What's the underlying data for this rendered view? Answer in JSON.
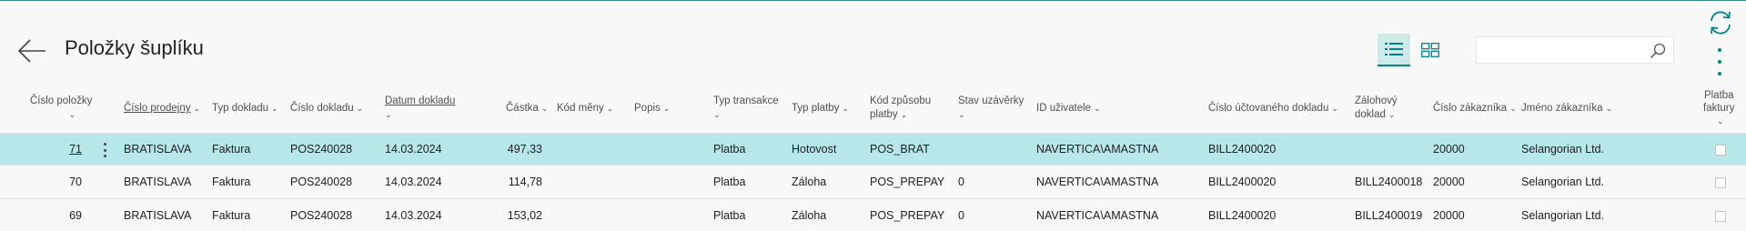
{
  "header": {
    "title": "Položky šuplíku",
    "search": {
      "value": "",
      "placeholder": ""
    },
    "icons": {
      "back": "back-arrow-icon",
      "list_view": "list-view-icon",
      "tile_view": "tile-view-icon",
      "search": "search-icon",
      "refresh": "refresh-icon",
      "more": "more-options-icon"
    },
    "accent_color": "#008489"
  },
  "columns": [
    {
      "key": "cislo_polozky",
      "label1": "Číslo položky",
      "label2": ""
    },
    {
      "key": "cislo_prodejny",
      "label1": "Číslo prodejny",
      "label2": ""
    },
    {
      "key": "typ_dokladu",
      "label1": "Typ dokladu",
      "label2": ""
    },
    {
      "key": "cislo_dokladu",
      "label1": "Číslo dokladu",
      "label2": ""
    },
    {
      "key": "datum_dokladu",
      "label1": "Datum dokladu",
      "label2": ""
    },
    {
      "key": "castka",
      "label1": "Částka",
      "label2": ""
    },
    {
      "key": "kod_meny",
      "label1": "Kód měny",
      "label2": ""
    },
    {
      "key": "popis",
      "label1": "Popis",
      "label2": ""
    },
    {
      "key": "typ_transakce",
      "label1": "Typ transakce",
      "label2": ""
    },
    {
      "key": "typ_platby",
      "label1": "Typ platby",
      "label2": ""
    },
    {
      "key": "kod_zpusobu_platby",
      "label1": "Kód způsobu",
      "label2": "platby"
    },
    {
      "key": "stav_uzaverky",
      "label1": "Stav uzávěrky",
      "label2": ""
    },
    {
      "key": "id_uzivatele",
      "label1": "ID uživatele",
      "label2": ""
    },
    {
      "key": "cislo_uctovaneho_dokladu",
      "label1": "Číslo účtovaného dokladu",
      "label2": ""
    },
    {
      "key": "zalohovy_doklad",
      "label1": "Zálohový",
      "label2": "doklad"
    },
    {
      "key": "cislo_zakaznika",
      "label1": "Číslo zákazníka",
      "label2": ""
    },
    {
      "key": "jmeno_zakaznika",
      "label1": "Jméno zákazníka",
      "label2": ""
    },
    {
      "key": "platba_faktury",
      "label1": "Platba",
      "label2": "faktury"
    }
  ],
  "rows": [
    {
      "cislo_polozky": "71",
      "cislo_prodejny": "BRATISLAVA",
      "typ_dokladu": "Faktura",
      "cislo_dokladu": "POS240028",
      "datum_dokladu": "14.03.2024",
      "castka": "497,33",
      "kod_meny": "",
      "popis": "",
      "typ_transakce": "Platba",
      "typ_platby": "Hotovost",
      "kod_zpusobu_platby": "POS_BRAT",
      "stav_uzaverky": "",
      "id_uzivatele": "NAVERTICA\\AMASTNA",
      "cislo_uctovaneho_dokladu": "BILL2400020",
      "zalohovy_doklad": "",
      "cislo_zakaznika": "20000",
      "jmeno_zakaznika": "Selangorian Ltd.",
      "platba_faktury": false,
      "selected": true
    },
    {
      "cislo_polozky": "70",
      "cislo_prodejny": "BRATISLAVA",
      "typ_dokladu": "Faktura",
      "cislo_dokladu": "POS240028",
      "datum_dokladu": "14.03.2024",
      "castka": "114,78",
      "kod_meny": "",
      "popis": "",
      "typ_transakce": "Platba",
      "typ_platby": "Záloha",
      "kod_zpusobu_platby": "POS_PREPAY",
      "stav_uzaverky": "0",
      "id_uzivatele": "NAVERTICA\\AMASTNA",
      "cislo_uctovaneho_dokladu": "BILL2400020",
      "zalohovy_doklad": "BILL2400018",
      "cislo_zakaznika": "20000",
      "jmeno_zakaznika": "Selangorian Ltd.",
      "platba_faktury": false,
      "selected": false
    },
    {
      "cislo_polozky": "69",
      "cislo_prodejny": "BRATISLAVA",
      "typ_dokladu": "Faktura",
      "cislo_dokladu": "POS240028",
      "datum_dokladu": "14.03.2024",
      "castka": "153,02",
      "kod_meny": "",
      "popis": "",
      "typ_transakce": "Platba",
      "typ_platby": "Záloha",
      "kod_zpusobu_platby": "POS_PREPAY",
      "stav_uzaverky": "0",
      "id_uzivatele": "NAVERTICA\\AMASTNA",
      "cislo_uctovaneho_dokladu": "BILL2400020",
      "zalohovy_doklad": "BILL2400019",
      "cislo_zakaznika": "20000",
      "jmeno_zakaznika": "Selangorian Ltd.",
      "platba_faktury": false,
      "selected": false
    }
  ]
}
